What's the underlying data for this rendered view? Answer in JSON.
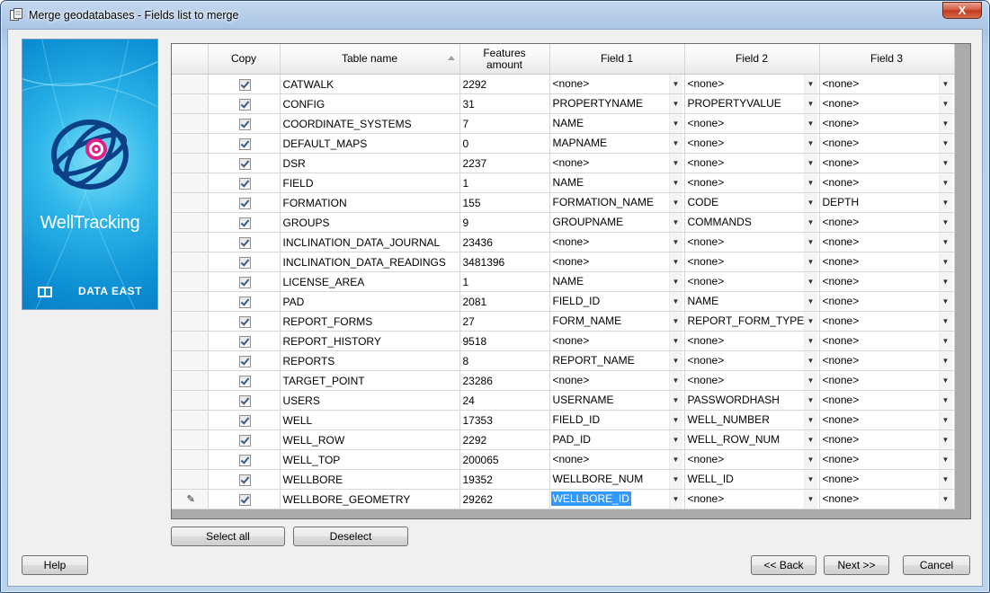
{
  "window": {
    "title": "Merge geodatabases - Fields list to merge",
    "close_label": "X"
  },
  "logo": {
    "name": "WellTracking",
    "brand": "DATA EAST"
  },
  "grid": {
    "headers": {
      "copy": "Copy",
      "table": "Table name",
      "features_line1": "Features",
      "features_line2": "amount",
      "field1": "Field 1",
      "field2": "Field 2",
      "field3": "Field 3"
    },
    "rows": [
      {
        "table": "CATWALK",
        "count": "2292",
        "f1": "<none>",
        "f2": "<none>",
        "f3": "<none>"
      },
      {
        "table": "CONFIG",
        "count": "31",
        "f1": "PROPERTYNAME",
        "f2": "PROPERTYVALUE",
        "f3": "<none>"
      },
      {
        "table": "COORDINATE_SYSTEMS",
        "count": "7",
        "f1": "NAME",
        "f2": "<none>",
        "f3": "<none>"
      },
      {
        "table": "DEFAULT_MAPS",
        "count": "0",
        "f1": "MAPNAME",
        "f2": "<none>",
        "f3": "<none>"
      },
      {
        "table": "DSR",
        "count": "2237",
        "f1": "<none>",
        "f2": "<none>",
        "f3": "<none>"
      },
      {
        "table": "FIELD",
        "count": "1",
        "f1": "NAME",
        "f2": "<none>",
        "f3": "<none>"
      },
      {
        "table": "FORMATION",
        "count": "155",
        "f1": "FORMATION_NAME",
        "f2": "CODE",
        "f3": "DEPTH"
      },
      {
        "table": "GROUPS",
        "count": "9",
        "f1": "GROUPNAME",
        "f2": "COMMANDS",
        "f3": "<none>"
      },
      {
        "table": "INCLINATION_DATA_JOURNAL",
        "count": "23436",
        "f1": "<none>",
        "f2": "<none>",
        "f3": "<none>"
      },
      {
        "table": "INCLINATION_DATA_READINGS",
        "count": "3481396",
        "f1": "<none>",
        "f2": "<none>",
        "f3": "<none>"
      },
      {
        "table": "LICENSE_AREA",
        "count": "1",
        "f1": "NAME",
        "f2": "<none>",
        "f3": "<none>"
      },
      {
        "table": "PAD",
        "count": "2081",
        "f1": "FIELD_ID",
        "f2": "NAME",
        "f3": "<none>"
      },
      {
        "table": "REPORT_FORMS",
        "count": "27",
        "f1": "FORM_NAME",
        "f2": "REPORT_FORM_TYPE",
        "f3": "<none>"
      },
      {
        "table": "REPORT_HISTORY",
        "count": "9518",
        "f1": "<none>",
        "f2": "<none>",
        "f3": "<none>"
      },
      {
        "table": "REPORTS",
        "count": "8",
        "f1": "REPORT_NAME",
        "f2": "<none>",
        "f3": "<none>"
      },
      {
        "table": "TARGET_POINT",
        "count": "23286",
        "f1": "<none>",
        "f2": "<none>",
        "f3": "<none>"
      },
      {
        "table": "USERS",
        "count": "24",
        "f1": "USERNAME",
        "f2": "PASSWORDHASH",
        "f3": "<none>"
      },
      {
        "table": "WELL",
        "count": "17353",
        "f1": "FIELD_ID",
        "f2": "WELL_NUMBER",
        "f3": "<none>"
      },
      {
        "table": "WELL_ROW",
        "count": "2292",
        "f1": "PAD_ID",
        "f2": "WELL_ROW_NUM",
        "f3": "<none>"
      },
      {
        "table": "WELL_TOP",
        "count": "200065",
        "f1": "<none>",
        "f2": "<none>",
        "f3": "<none>"
      },
      {
        "table": "WELLBORE",
        "count": "19352",
        "f1": "WELLBORE_NUM",
        "f2": "WELL_ID",
        "f3": "<none>"
      },
      {
        "table": "WELLBORE_GEOMETRY",
        "count": "29262",
        "f1": "WELLBORE_ID",
        "f2": "<none>",
        "f3": "<none>"
      }
    ]
  },
  "buttons": {
    "select_all": "Select all",
    "deselect": "Deselect",
    "help": "Help",
    "back": "<< Back",
    "next": "Next >>",
    "cancel": "Cancel"
  }
}
